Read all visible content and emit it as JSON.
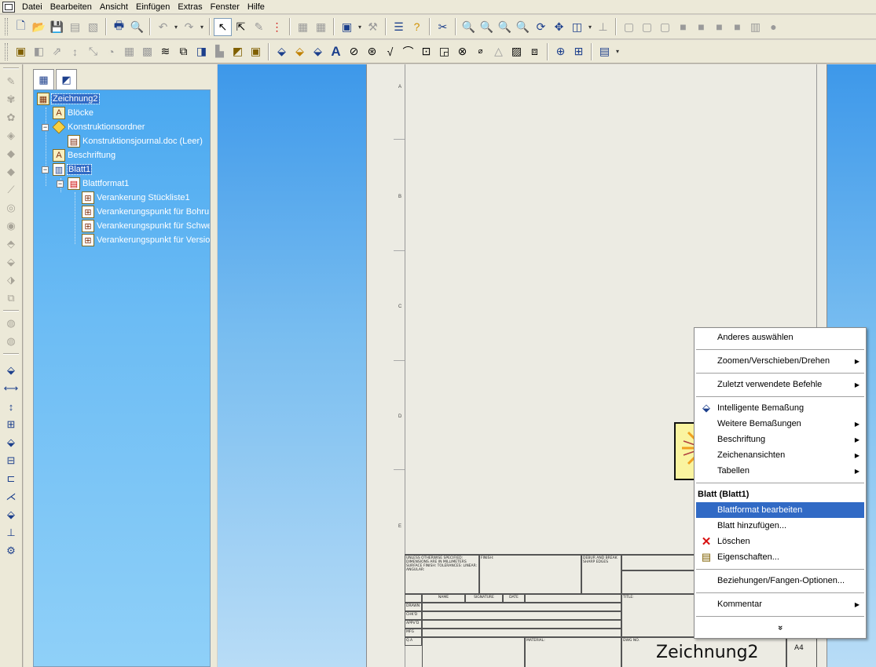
{
  "menubar": {
    "items": [
      "Datei",
      "Bearbeiten",
      "Ansicht",
      "Einfügen",
      "Extras",
      "Fenster",
      "Hilfe"
    ]
  },
  "toolbar1": {
    "icons": [
      "new-document-icon",
      "open-folder-icon",
      "save-icon",
      "print-preview-icon",
      "publish-icon",
      "print-icon",
      "print-preview-page-icon",
      "undo-icon",
      "redo-icon",
      "select-arrow-icon",
      "select-icon",
      "sketch-icon",
      "traffic-light-icon",
      "grid-icon",
      "grid-options-icon",
      "options-icon",
      "help-icon",
      "smart-dimension-icon",
      "zoom-fit-icon",
      "zoom-area-icon",
      "zoom-in-out-icon",
      "zoom-selection-icon",
      "rotate-icon",
      "pan-icon",
      "view-orientation-icon",
      "normal-to-icon",
      "front-view-icon",
      "back-view-icon",
      "left-view-icon",
      "right-view-icon",
      "top-view-icon",
      "bottom-view-icon",
      "isometric-view-icon",
      "render-icon"
    ]
  },
  "toolbar2": {
    "icons": [
      "drawing-view-icon",
      "projected-view-icon",
      "auxiliary-view-icon",
      "section-view-icon",
      "aligned-section-icon",
      "detail-view-icon",
      "broken-view-icon",
      "crop-view-icon",
      "break-line-icon",
      "alternate-position-icon",
      "standard-views-icon",
      "model-view-icon",
      "predefined-view-icon",
      "smart-dimension-icon",
      "autodim-icon",
      "dimxpert-icon",
      "note-icon",
      "balloon-icon",
      "auto-balloon-icon",
      "surface-finish-icon",
      "weld-symbol-icon",
      "geometric-tolerance-icon",
      "datum-feature-icon",
      "datum-target-icon",
      "hole-callout-icon",
      "revision-symbol-icon",
      "area-hatch-icon",
      "block-icon",
      "center-mark-icon",
      "centerline-icon",
      "table-icon"
    ]
  },
  "left_toolbar": {
    "icons": [
      "sketch-tool-1-icon",
      "sketch-tool-2-icon",
      "sketch-tool-3-icon",
      "sketch-tool-4-icon",
      "sketch-tool-5-icon",
      "sketch-tool-6-icon",
      "sketch-tool-7-icon",
      "sketch-tool-8-icon",
      "sketch-tool-9-icon",
      "sketch-tool-10-icon",
      "sketch-tool-11-icon",
      "sketch-tool-12-icon",
      "sketch-tool-13-icon",
      "sketch-tool-14-icon",
      "sketch-tool-15-icon",
      "sketch-tool-16-icon",
      "smart-dimension-icon",
      "horizontal-dimension-icon",
      "vertical-dimension-icon",
      "baseline-dimension-icon",
      "ordinate-dimension-icon",
      "horizontal-ordinate-icon",
      "vertical-ordinate-icon",
      "chamfer-dimension-icon",
      "autodim-icon",
      "fully-defined-icon",
      "relations-icon",
      "scan-equal-icon"
    ]
  },
  "feature_tree": {
    "tabs": [
      "feature-manager-tab-icon",
      "property-manager-tab-icon"
    ],
    "items": [
      {
        "label": "Zeichnung2",
        "icon": "drawing-icon"
      },
      {
        "label": "Blöcke",
        "icon": "blocks-icon"
      },
      {
        "label": "Konstruktionsordner",
        "icon": "design-binder-icon"
      },
      {
        "label": "Konstruktionsjournal.doc (Leer)",
        "icon": "journal-doc-icon"
      },
      {
        "label": "Beschriftung",
        "icon": "annotations-icon"
      },
      {
        "label": "Blatt1",
        "icon": "sheet-icon"
      },
      {
        "label": "Blattformat1",
        "icon": "sheet-format-icon"
      },
      {
        "label": "Verankerung Stückliste1",
        "icon": "bom-anchor-icon"
      },
      {
        "label": "Verankerungspunkt für Bohru",
        "icon": "hole-table-anchor-icon"
      },
      {
        "label": "Verankerungspunkt für Schwe",
        "icon": "weldment-anchor-icon"
      },
      {
        "label": "Verankerungspunkt für Versio",
        "icon": "revision-anchor-icon"
      }
    ]
  },
  "sheet": {
    "drawing_name": "Zeichnung2",
    "sheet_size": "A4",
    "zone_marks": [
      "A",
      "B",
      "C",
      "D",
      "E"
    ],
    "titleblock": {
      "tolerances": "UNLESS OTHERWISE SPECIFIED: DIMENSIONS ARE IN MILLIMETERS SURFACE FINISH: TOLERANCES: LINEAR: ANGULAR:",
      "finish": "FINISH:",
      "deburr": "DEBUR AND BREAK SHARP EDGES",
      "do_not_scale": "DO NOT SCALE DRAWING",
      "name": "NAME",
      "signature": "SIGNATURE",
      "date": "DATE",
      "drawn": "DRAWN",
      "chkd": "CHK'D",
      "appvd": "APPV'D",
      "mfg": "MFG",
      "qa": "Q.A",
      "material": "MATERIAL:",
      "title": "TITLE:",
      "dwg_no": "DWG NO."
    }
  },
  "context_menu": {
    "items": [
      {
        "label": "Anderes auswählen",
        "submenu": false
      },
      {
        "label": "Zoomen/Verschieben/Drehen",
        "submenu": true
      },
      {
        "label": "Zuletzt verwendete Befehle",
        "submenu": true
      },
      {
        "label": "Intelligente Bemaßung",
        "submenu": false,
        "icon": "smart-dimension-icon"
      },
      {
        "label": "Weitere Bemaßungen",
        "submenu": true
      },
      {
        "label": "Beschriftung",
        "submenu": true
      },
      {
        "label": "Zeichenansichten",
        "submenu": true
      },
      {
        "label": "Tabellen",
        "submenu": true
      },
      {
        "label": "Blattformat bearbeiten",
        "submenu": false,
        "highlighted": true
      },
      {
        "label": "Blatt hinzufügen...",
        "submenu": false
      },
      {
        "label": "Löschen",
        "submenu": false,
        "icon": "delete-x-icon"
      },
      {
        "label": "Eigenschaften...",
        "submenu": false,
        "icon": "properties-icon"
      },
      {
        "label": "Beziehungen/Fangen-Optionen...",
        "submenu": false
      },
      {
        "label": "Kommentar",
        "submenu": true
      }
    ],
    "section_header": "Blatt (Blatt1)",
    "more": "»"
  },
  "colors": {
    "highlight": "#316ac5",
    "tree_bg": "#4aa8f0",
    "delete_red": "#d81010",
    "sheet_bg": "#ecebe3"
  }
}
